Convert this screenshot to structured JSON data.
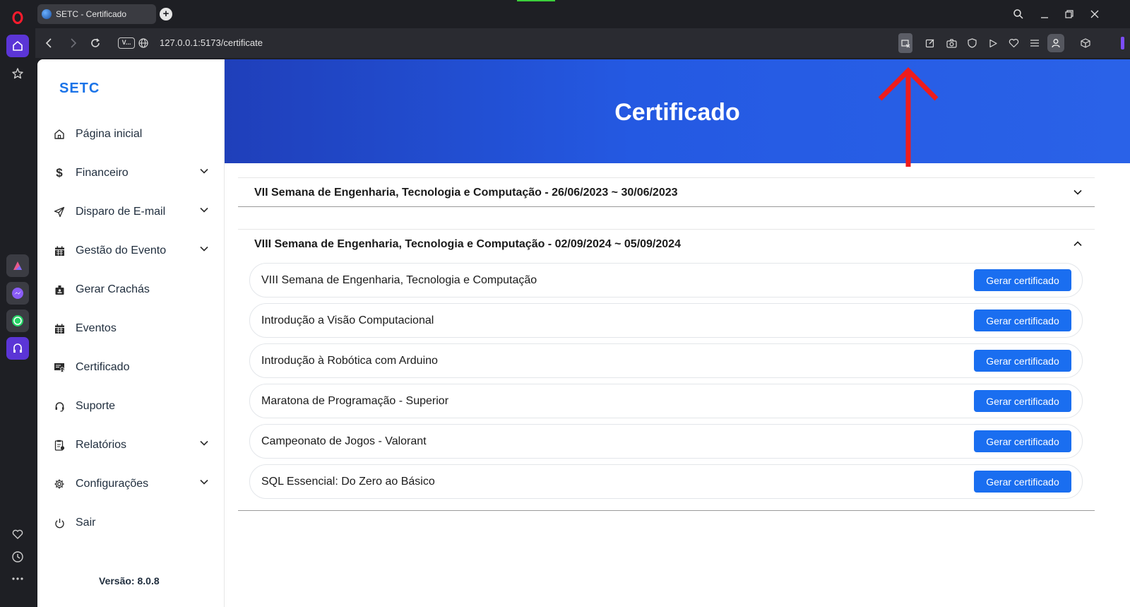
{
  "browser": {
    "tab_title": "SETC - Certificado",
    "url_badge": "V...",
    "url": "127.0.0.1:5173/certificate",
    "accent_purple": "#7c4dff",
    "rail_icons": [
      "opera-logo-icon",
      "home-icon",
      "star-icon",
      "aria-icon",
      "messenger-icon",
      "whatsapp-icon",
      "music-icon",
      "heart-icon",
      "history-icon",
      "more-icon"
    ],
    "toolbar_icons": [
      "extensions-icon",
      "snapshot-edit-icon",
      "camera-icon",
      "shield-icon",
      "player-icon",
      "heart-icon",
      "easy-setup-icon",
      "profile-icon",
      "cube-icon"
    ]
  },
  "sidebar": {
    "brand": "SETC",
    "items": [
      {
        "label": "Página inicial",
        "icon": "home-icon",
        "expandable": false
      },
      {
        "label": "Financeiro",
        "icon": "dollar-icon",
        "expandable": true
      },
      {
        "label": "Disparo de E-mail",
        "icon": "send-icon",
        "expandable": true
      },
      {
        "label": "Gestão do Evento",
        "icon": "calendar-icon",
        "expandable": true
      },
      {
        "label": "Gerar Crachás",
        "icon": "badge-icon",
        "expandable": false
      },
      {
        "label": "Eventos",
        "icon": "calendar-icon",
        "expandable": false
      },
      {
        "label": "Certificado",
        "icon": "certificate-icon",
        "expandable": false
      },
      {
        "label": "Suporte",
        "icon": "headset-icon",
        "expandable": false
      },
      {
        "label": "Relatórios",
        "icon": "report-icon",
        "expandable": true
      },
      {
        "label": "Configurações",
        "icon": "gear-icon",
        "expandable": true
      },
      {
        "label": "Sair",
        "icon": "power-icon",
        "expandable": false
      }
    ],
    "version": "Versão: 8.0.8"
  },
  "main": {
    "title": "Certificado",
    "hero_color": "#2459e2",
    "button_color": "#1a6ef0",
    "events": [
      {
        "header": "VII Semana de Engenharia, Tecnologia e Computação - 26/06/2023 ~ 30/06/2023",
        "expanded": false,
        "activities": []
      },
      {
        "header": "VIII Semana de Engenharia, Tecnologia e Computação - 02/09/2024 ~ 05/09/2024",
        "expanded": true,
        "activities": [
          {
            "name": "VIII Semana de Engenharia, Tecnologia e Computação",
            "button": "Gerar certificado"
          },
          {
            "name": "Introdução a Visão Computacional",
            "button": "Gerar certificado"
          },
          {
            "name": "Introdução à Robótica com Arduino",
            "button": "Gerar certificado"
          },
          {
            "name": "Maratona de Programação - Superior",
            "button": "Gerar certificado"
          },
          {
            "name": "Campeonato de Jogos - Valorant",
            "button": "Gerar certificado"
          },
          {
            "name": "SQL Essencial: Do Zero ao Básico",
            "button": "Gerar certificado"
          }
        ]
      }
    ]
  }
}
